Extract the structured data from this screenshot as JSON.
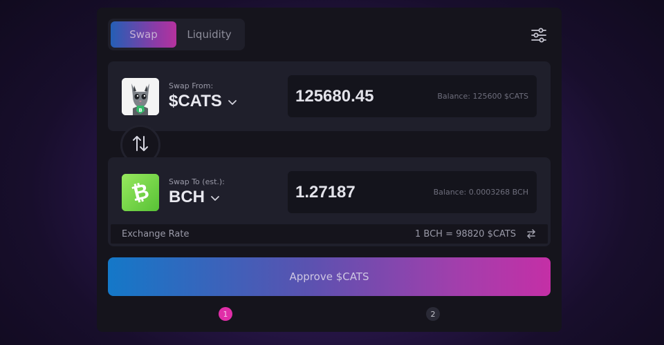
{
  "tabs": [
    {
      "label": "Swap",
      "active": true
    },
    {
      "label": "Liquidity",
      "active": false
    }
  ],
  "settings_icon": "sliders-icon",
  "swap_from": {
    "label": "Swap From:",
    "token": "$CATS",
    "amount": "125680.45",
    "balance": "Balance: 125600 $CATS",
    "logo": "cat-token-logo"
  },
  "swap_direction_icon": "swap-vertical-arrows-icon",
  "swap_to": {
    "label": "Swap To (est.):",
    "token": "BCH",
    "amount": "1.27187",
    "balance": "Balance: 0.0003268 BCH",
    "logo": "bitcoin-cash-logo"
  },
  "exchange_rate": {
    "label": "Exchange Rate",
    "value": "1 BCH = 98820 $CATS"
  },
  "approve_button": "Approve $CATS",
  "steps": [
    {
      "number": "1",
      "active": true
    },
    {
      "number": "2",
      "active": false
    }
  ],
  "colors": {
    "accent_pink": "#e02ea8",
    "accent_blue": "#1478c8",
    "bch_green": "#8ee25a"
  }
}
